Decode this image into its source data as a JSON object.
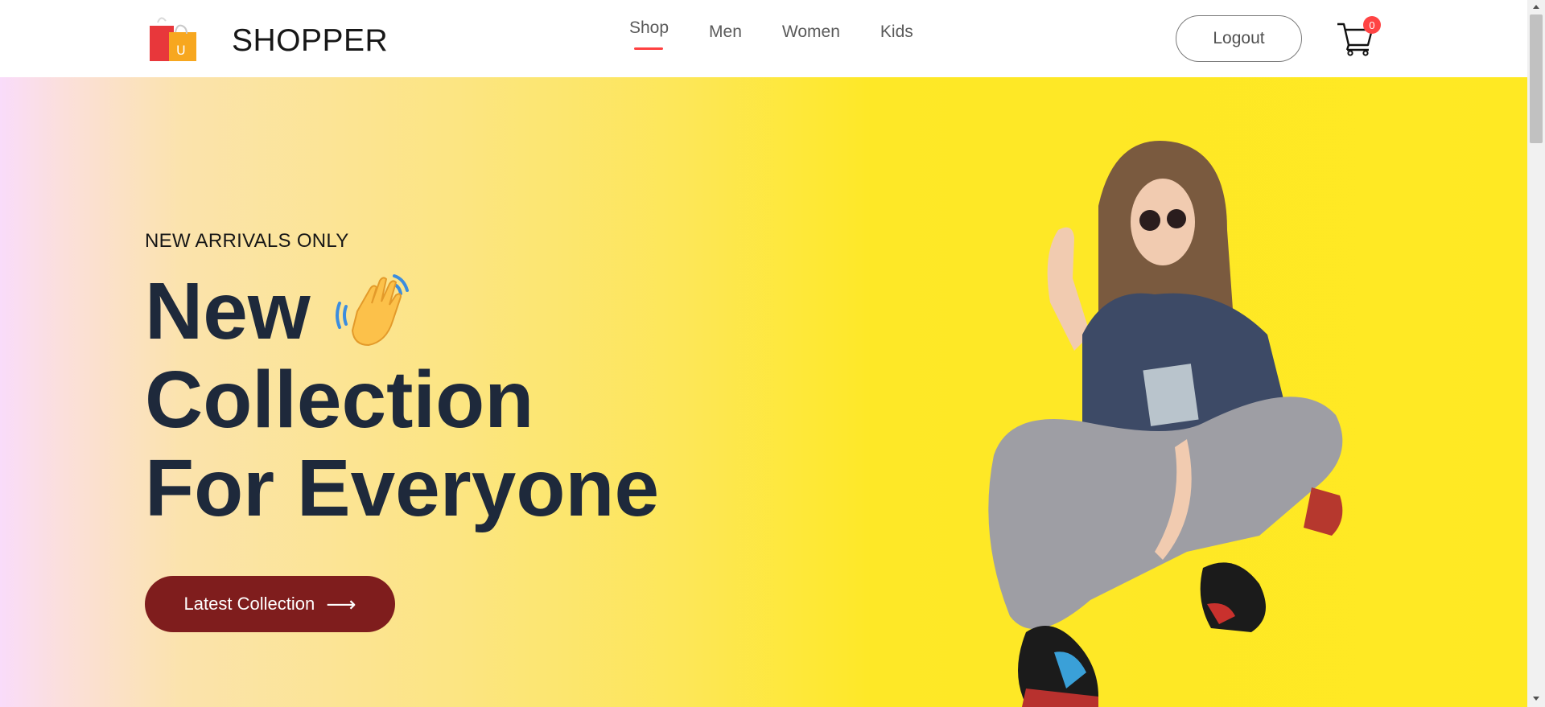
{
  "brand": {
    "name": "SHOPPER",
    "logo_badge": "U"
  },
  "nav": {
    "items": [
      {
        "label": "Shop",
        "active": true
      },
      {
        "label": "Men"
      },
      {
        "label": "Women"
      },
      {
        "label": "Kids"
      }
    ]
  },
  "header": {
    "logout_label": "Logout",
    "cart_count": "0",
    "cart_icon": "cart-icon"
  },
  "hero": {
    "eyebrow": "NEW ARRIVALS ONLY",
    "title_line1": "New",
    "title_line2": "Collection",
    "title_line3": "For Everyone",
    "cta_label": "Latest Collection",
    "cta_arrow": "⟶"
  },
  "colors": {
    "accent": "#ff4141",
    "cta": "#7f1d1d",
    "hero_yellow": "#ffe923",
    "title": "#1e293b"
  }
}
